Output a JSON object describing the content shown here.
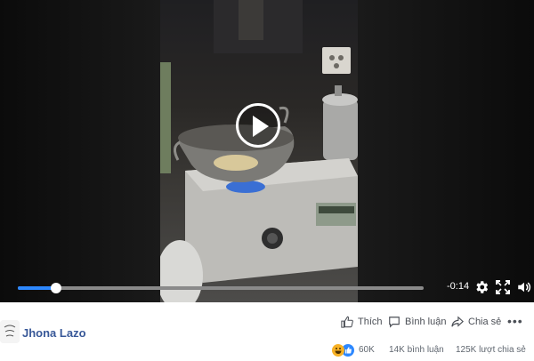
{
  "player": {
    "progress": 0.095,
    "time_remaining": "-0:14",
    "state": "paused",
    "icons": {
      "play": "play-icon",
      "settings": "gear-icon",
      "fullscreen": "fullscreen-icon",
      "volume": "volume-icon"
    }
  },
  "post": {
    "page_name": "Jhona Lazo",
    "actions": {
      "like": "Thích",
      "comment": "Bình luận",
      "share": "Chia sẻ"
    },
    "stats": {
      "reactions": "60K",
      "comments": "14K bình luận",
      "shares": "125K lượt chia sẻ"
    }
  },
  "colors": {
    "accent": "#2d88ff",
    "link": "#385898",
    "text": "#4b4f56",
    "muted": "#606770"
  }
}
